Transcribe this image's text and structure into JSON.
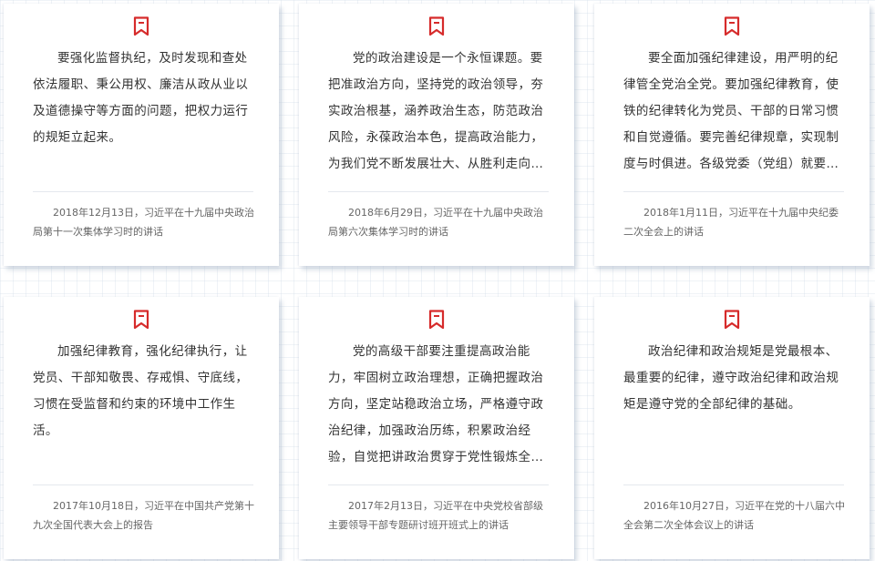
{
  "colors": {
    "accent": "#d62b2b",
    "text": "#333333",
    "source_text": "#666666",
    "card_bg": "#ffffff"
  },
  "cards": [
    {
      "icon": "bookmark-icon",
      "quote": "要强化监督执纪，及时发现和查处依法履职、秉公用权、廉洁从政从业以及道德操守等方面的问题，把权力运行的规矩立起来。",
      "source": "2018年12月13日，习近平在十九届中央政治局第十一次集体学习时的讲话"
    },
    {
      "icon": "bookmark-icon",
      "quote": "党的政治建设是一个永恒课题。要把准政治方向，坚持党的政治领导，夯实政治根基，涵养政治生态，防范政治风险，永葆政治本色，提高政治能力，为我们党不断发展壮大、从胜利走向胜利提供重...",
      "source": "2018年6月29日，习近平在十九届中央政治局第六次集体学习时的讲话"
    },
    {
      "icon": "bookmark-icon",
      "quote": "要全面加强纪律建设，用严明的纪律管全党治全党。要加强纪律教育，使铁的纪律转化为党员、干部的日常习惯和自觉遵循。要完善纪律规章，实现制度与时俱进。各级党委（党组）就要敢抓敢管、...",
      "source": "2018年1月11日，习近平在十九届中央纪委二次全会上的讲话"
    },
    {
      "icon": "bookmark-icon",
      "quote": "加强纪律教育，强化纪律执行，让党员、干部知敬畏、存戒惧、守底线，习惯在受监督和约束的环境中工作生活。",
      "source": "2017年10月18日，习近平在中国共产党第十九次全国代表大会上的报告"
    },
    {
      "icon": "bookmark-icon",
      "quote": "党的高级干部要注重提高政治能力，牢固树立政治理想，正确把握政治方向，坚定站稳政治立场，严格遵守政治纪律，加强政治历练，积累政治经验，自觉把讲政治贯穿于党性锻炼全过程，使自己的...",
      "source": "2017年2月13日，习近平在中央党校省部级主要领导干部专题研讨班开班式上的讲话"
    },
    {
      "icon": "bookmark-icon",
      "quote": "政治纪律和政治规矩是党最根本、最重要的纪律，遵守政治纪律和政治规矩是遵守党的全部纪律的基础。",
      "source": "2016年10月27日，习近平在党的十八届六中全会第二次全体会议上的讲话"
    }
  ]
}
